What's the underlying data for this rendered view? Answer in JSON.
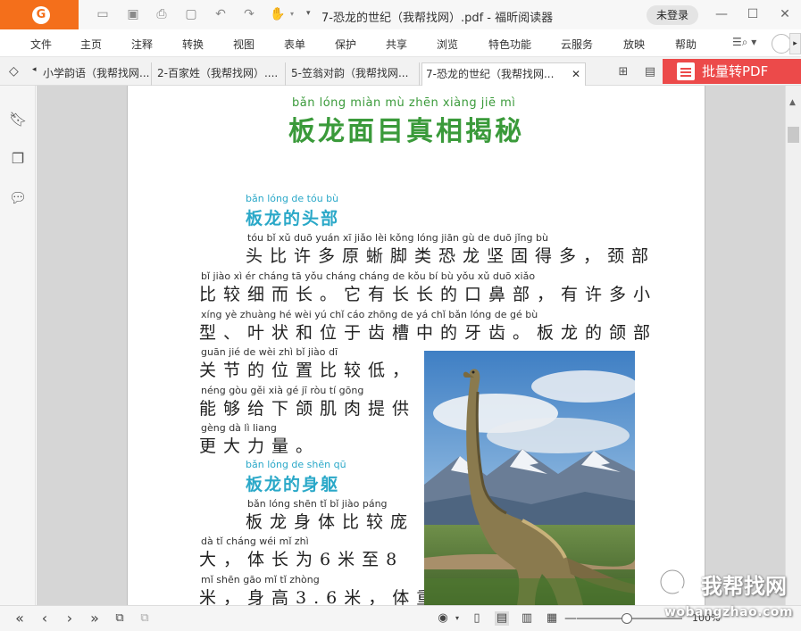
{
  "window": {
    "title": "7-恐龙的世纪（我帮找网）.pdf - 福昕阅读器",
    "login_label": "未登录"
  },
  "menu": [
    "文件",
    "主页",
    "注释",
    "转换",
    "视图",
    "表单",
    "保护",
    "共享",
    "浏览",
    "特色功能",
    "云服务",
    "放映",
    "帮助"
  ],
  "tabs": [
    {
      "label": "小学韵语（我帮找网..."
    },
    {
      "label": "2-百家姓（我帮找网）...."
    },
    {
      "label": "5-笠翁对韵（我帮找网..."
    },
    {
      "label": "7-恐龙的世纪（我帮找网...",
      "active": true
    }
  ],
  "batch_button": "批量转PDF",
  "document": {
    "title_pinyin": "bǎn lóng miàn mù zhēn xiàng jiē mì",
    "title": "板龙面目真相揭秘",
    "sections": [
      {
        "heading_pinyin": "bǎn lóng de tóu bù",
        "heading": "板龙的头部",
        "lines": [
          {
            "pinyin": "tóu   bǐ   xǔ   duō yuán  xī   jiǎo   lèi  kǒng lóng  jiān  gù   de   duō            jǐng   bù",
            "text": "头比许多原蜥脚类恐龙坚固得多，颈部"
          },
          {
            "pinyin": "bǐ   jiào   xì   ér  cháng         tā   yǒu cháng cháng  de   kǒu   bí    bù         yǒu   xǔ   duō  xiǎo",
            "text": "比较细而长。它有长长的口鼻部，有许多小"
          },
          {
            "pinyin": "xíng         yè zhuàng  hé   wèi   yú   chǐ   cáo zhōng  de   yá   chǐ         bǎn  lóng  de   gé   bù",
            "text": "型、叶状和位于齿槽中的牙齿。板龙的颌部"
          },
          {
            "pinyin": "guān  jié   de   wèi   zhì   bǐ   jiào   dī",
            "text": "关节的位置比较低，"
          },
          {
            "pinyin": "néng gòu   gěi   xià   gé    jī   ròu   tí   gōng",
            "text": "能够给下颌肌肉提供"
          },
          {
            "pinyin": "gèng  dà   lì  liang",
            "text": "更大力量。"
          }
        ]
      },
      {
        "heading_pinyin": "bǎn lóng de shēn qū",
        "heading": "板龙的身躯",
        "lines": [
          {
            "pinyin": "bǎn  lóng shēn  tǐ   bǐ  jiào  páng",
            "text": "板龙身体比较庞"
          },
          {
            "pinyin": "dà         tǐ  cháng  wéi        mǐ   zhì",
            "text": "大，体长为6米至8"
          },
          {
            "pinyin": "mǐ        shēn gāo          mǐ        tǐ zhòng",
            "text": "米，身高3.6米，体重"
          }
        ]
      }
    ]
  },
  "watermark": {
    "text": "我帮找网",
    "url": "wobangzhao.com"
  },
  "statusbar": {
    "zoom": "100%"
  },
  "icons": {
    "logo": "foxit-logo-icon",
    "open": "folder-open-icon",
    "save": "save-icon",
    "print": "print-icon",
    "new": "new-file-icon",
    "undo": "undo-icon",
    "redo": "redo-icon",
    "hand": "hand-tool-icon"
  },
  "colors": {
    "brand": "#f46f1b",
    "batch": "#ec4a4a",
    "title_green": "#3a9a3a",
    "heading_blue": "#2aa8c8"
  }
}
